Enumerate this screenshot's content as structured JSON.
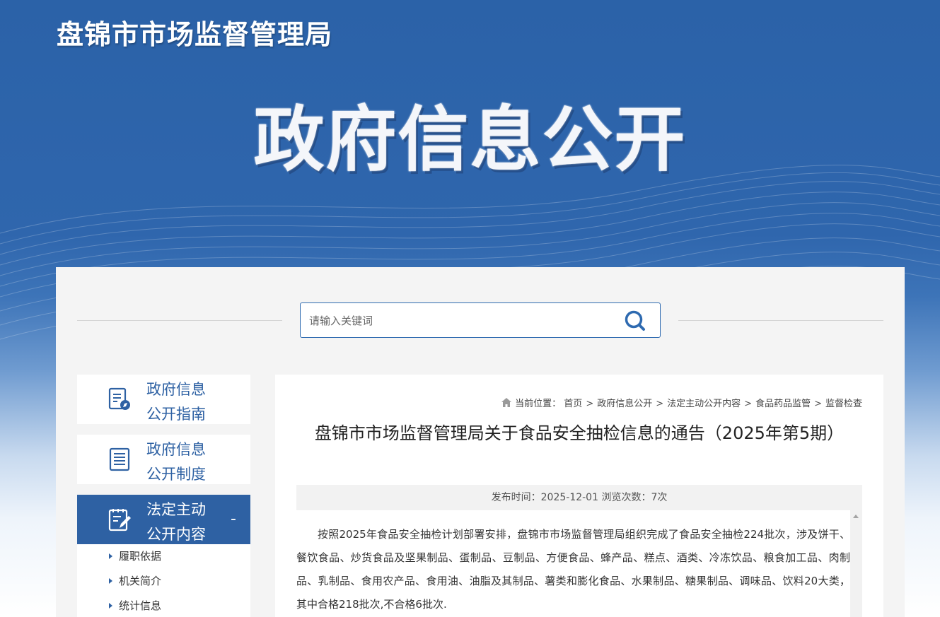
{
  "header": {
    "site_name": "盘锦市市场监督管理局",
    "banner_title": "政府信息公开"
  },
  "search": {
    "placeholder": "请输入关键词",
    "value": "",
    "icon": "search-icon"
  },
  "sidebar": {
    "items": [
      {
        "line1": "政府信息",
        "line2": "公开指南",
        "icon": "guide-icon",
        "active": false
      },
      {
        "line1": "政府信息",
        "line2": "公开制度",
        "icon": "document-list-icon",
        "active": false
      },
      {
        "line1": "法定主动",
        "line2": "公开内容",
        "icon": "clipboard-edit-icon",
        "active": true,
        "toggle": "-"
      }
    ],
    "sub_items": [
      "履职依据",
      "机关简介",
      "统计信息"
    ]
  },
  "breadcrumb": {
    "prefix": "当前位置：",
    "items": [
      "首页",
      "政府信息公开",
      "法定主动公开内容",
      "食品药品监管",
      "监督检查"
    ]
  },
  "article": {
    "title": "盘锦市市场监督管理局关于食品安全抽检信息的通告（2025年第5期）",
    "meta": "发布时间：2025-12-01 浏览次数：7次",
    "body": "按照2025年食品安全抽检计划部署安排，盘锦市市场监督管理局组织完成了食品安全抽检224批次，涉及饼干、餐饮食品、炒货食品及坚果制品、蛋制品、豆制品、方便食品、蜂产品、糕点、酒类、冷冻饮品、粮食加工品、肉制品、乳制品、食用农产品、食用油、油脂及其制品、薯类和膨化食品、水果制品、糖果制品、调味品、饮料20大类，其中合格218批次,不合格6批次."
  },
  "colors": {
    "primary": "#2e61a3",
    "panel_bg": "#f4f4f4"
  }
}
